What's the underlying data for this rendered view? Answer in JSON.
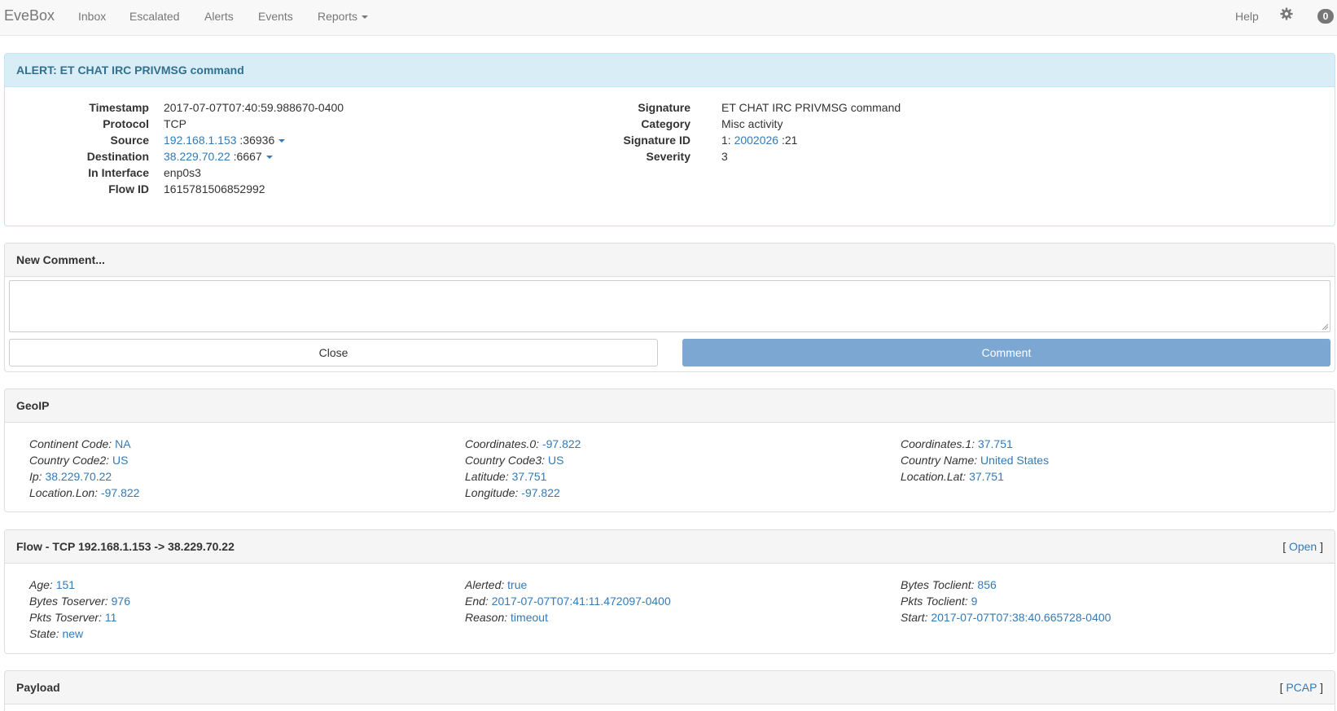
{
  "nav": {
    "brand": "EveBox",
    "items": [
      "Inbox",
      "Escalated",
      "Alerts",
      "Events",
      "Reports"
    ],
    "help": "Help",
    "badge": "0"
  },
  "alert": {
    "title": "ALERT: ET CHAT IRC PRIVMSG command",
    "left": {
      "timestamp_label": "Timestamp",
      "timestamp": "2017-07-07T07:40:59.988670-0400",
      "protocol_label": "Protocol",
      "protocol": "TCP",
      "source_label": "Source",
      "source_ip": "192.168.1.153",
      "source_port": ":36936",
      "destination_label": "Destination",
      "destination_ip": "38.229.70.22",
      "destination_port": ":6667",
      "interface_label": "In Interface",
      "interface": "enp0s3",
      "flow_id_label": "Flow ID",
      "flow_id": "1615781506852992"
    },
    "right": {
      "signature_label": "Signature",
      "signature": "ET CHAT IRC PRIVMSG command",
      "category_label": "Category",
      "category": "Misc activity",
      "sid_label": "Signature ID",
      "sid_gid": "1:",
      "sid": "2002026",
      "sid_rev": ":21",
      "severity_label": "Severity",
      "severity": "3"
    }
  },
  "comment": {
    "heading": "New Comment...",
    "close_label": "Close",
    "comment_label": "Comment"
  },
  "geoip": {
    "heading": "GeoIP",
    "col1": [
      {
        "k": "Continent Code:",
        "v": "NA"
      },
      {
        "k": "Country Code2:",
        "v": "US"
      },
      {
        "k": "Ip:",
        "v": "38.229.70.22"
      },
      {
        "k": "Location.Lon:",
        "v": "-97.822"
      }
    ],
    "col2": [
      {
        "k": "Coordinates.0:",
        "v": "-97.822"
      },
      {
        "k": "Country Code3:",
        "v": "US"
      },
      {
        "k": "Latitude:",
        "v": "37.751"
      },
      {
        "k": "Longitude:",
        "v": "-97.822"
      }
    ],
    "col3": [
      {
        "k": "Coordinates.1:",
        "v": "37.751"
      },
      {
        "k": "Country Name:",
        "v": "United States"
      },
      {
        "k": "Location.Lat:",
        "v": "37.751"
      }
    ]
  },
  "flow": {
    "heading": "Flow - TCP 192.168.1.153 -> 38.229.70.22",
    "bracket_open": "[",
    "open_link": "Open",
    "bracket_close": "]",
    "col1": [
      {
        "k": "Age:",
        "v": "151"
      },
      {
        "k": "Bytes Toserver:",
        "v": "976"
      },
      {
        "k": "Pkts Toserver:",
        "v": "11"
      },
      {
        "k": "State:",
        "v": "new"
      }
    ],
    "col2": [
      {
        "k": "Alerted:",
        "v": "true"
      },
      {
        "k": "End:",
        "v": "2017-07-07T07:41:11.472097-0400"
      },
      {
        "k": "Reason:",
        "v": "timeout"
      }
    ],
    "col3": [
      {
        "k": "Bytes Toclient:",
        "v": "856"
      },
      {
        "k": "Pkts Toclient:",
        "v": "9"
      },
      {
        "k": "Start:",
        "v": "2017-07-07T07:38:40.665728-0400"
      }
    ]
  },
  "payload": {
    "heading": "Payload",
    "bracket_open": "[",
    "pcap_link": "PCAP",
    "bracket_close": "]"
  }
}
